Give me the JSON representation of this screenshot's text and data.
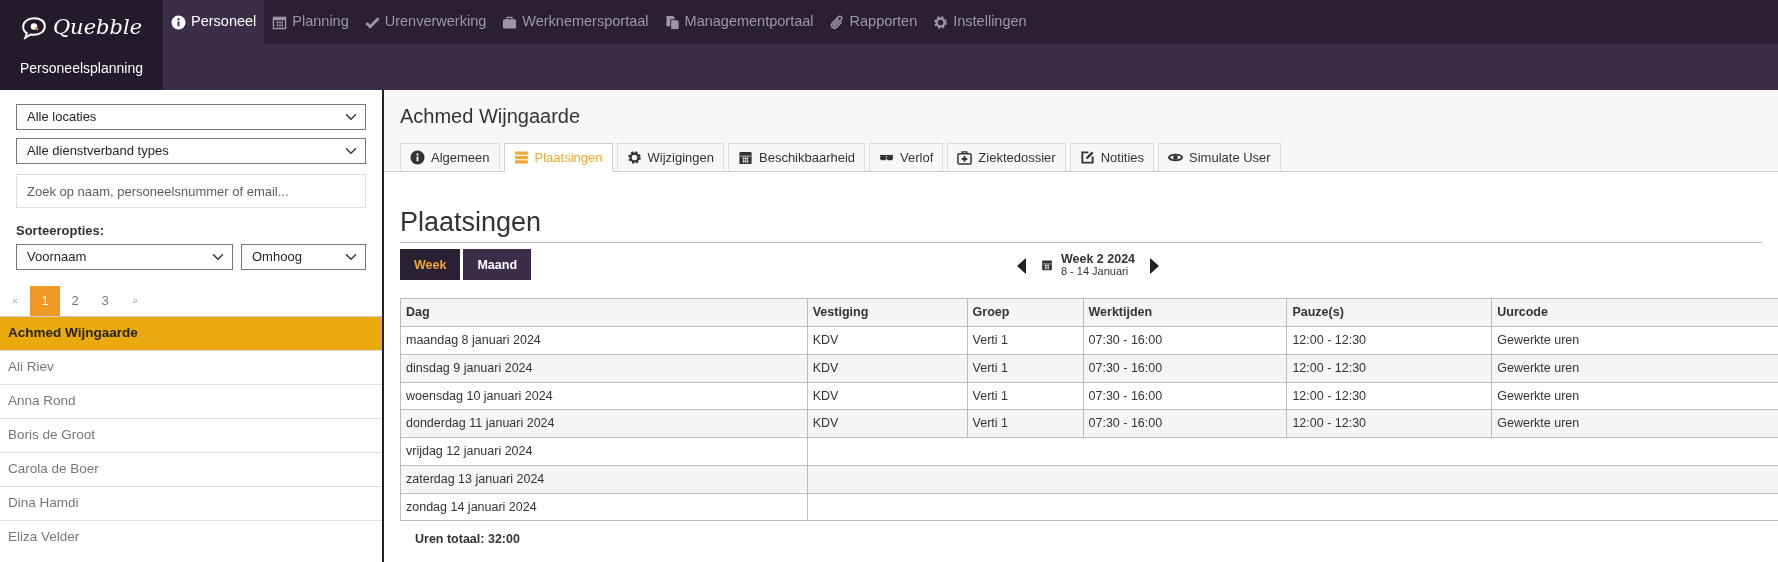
{
  "brand": {
    "name": "Quebble",
    "subtitle": "Personeelsplanning"
  },
  "nav": [
    {
      "label": "Personeel",
      "selected": true
    },
    {
      "label": "Planning",
      "selected": false
    },
    {
      "label": "Urenverwerking",
      "selected": false
    },
    {
      "label": "Werknemersportaal",
      "selected": false
    },
    {
      "label": "Managementportaal",
      "selected": false
    },
    {
      "label": "Rapporten",
      "selected": false
    },
    {
      "label": "Instellingen",
      "selected": false
    }
  ],
  "sidebar": {
    "filters": [
      {
        "value": "Alle locaties"
      },
      {
        "value": "Alle dienstverband types"
      }
    ],
    "search": {
      "placeholder": "Zoek op naam, personeelsnummer of email..."
    },
    "sort_label": "Sorteeropties:",
    "sort_field": "Voornaam",
    "sort_order": "Omhoog",
    "pagination": {
      "prev": "«",
      "next": "»",
      "pages": [
        {
          "label": "1",
          "selected": true
        },
        {
          "label": "2",
          "selected": false
        },
        {
          "label": "3",
          "selected": false
        }
      ]
    },
    "employees": [
      {
        "name": "Achmed Wijngaarde",
        "selected": true
      },
      {
        "name": "Ali Riev",
        "selected": false
      },
      {
        "name": "Anna Rond",
        "selected": false
      },
      {
        "name": "Boris de Groot",
        "selected": false
      },
      {
        "name": "Carola de Boer",
        "selected": false
      },
      {
        "name": "Dina Hamdi",
        "selected": false
      },
      {
        "name": "Eliza Velder",
        "selected": false
      }
    ]
  },
  "main": {
    "title": "Achmed Wijngaarde",
    "tabs": [
      {
        "label": "Algemeen",
        "selected": false
      },
      {
        "label": "Plaatsingen",
        "selected": true
      },
      {
        "label": "Wijzigingen",
        "selected": false
      },
      {
        "label": "Beschikbaarheid",
        "selected": false
      },
      {
        "label": "Verlof",
        "selected": false
      },
      {
        "label": "Ziektedossier",
        "selected": false
      },
      {
        "label": "Notities",
        "selected": false
      },
      {
        "label": "Simulate User",
        "selected": false
      }
    ],
    "heading": "Plaatsingen",
    "views": [
      {
        "label": "Week",
        "selected": true
      },
      {
        "label": "Maand",
        "selected": false
      }
    ],
    "period": {
      "title": "Week 2 2024",
      "range": "8 - 14 Januari"
    },
    "table": {
      "columns": [
        "Dag",
        "Vestiging",
        "Groep",
        "Werktijden",
        "Pauze(s)",
        "Uurcode"
      ],
      "rows": [
        {
          "cells": [
            "maandag 8 januari 2024",
            "KDV",
            "Verti 1",
            "07:30 - 16:00",
            "12:00 - 12:30",
            "Gewerkte uren"
          ]
        },
        {
          "cells": [
            "dinsdag 9 januari 2024",
            "KDV",
            "Verti 1",
            "07:30 - 16:00",
            "12:00 - 12:30",
            "Gewerkte uren"
          ]
        },
        {
          "cells": [
            "woensdag 10 januari 2024",
            "KDV",
            "Verti 1",
            "07:30 - 16:00",
            "12:00 - 12:30",
            "Gewerkte uren"
          ]
        },
        {
          "cells": [
            "donderdag 11 januari 2024",
            "KDV",
            "Verti 1",
            "07:30 - 16:00",
            "12:00 - 12:30",
            "Gewerkte uren"
          ]
        },
        {
          "cells": [
            "vrijdag 12 januari 2024"
          ]
        },
        {
          "cells": [
            "zaterdag 13 januari 2024"
          ]
        },
        {
          "cells": [
            "zondag 14 januari 2024"
          ]
        }
      ]
    },
    "total": "Uren totaal: 32:00"
  }
}
